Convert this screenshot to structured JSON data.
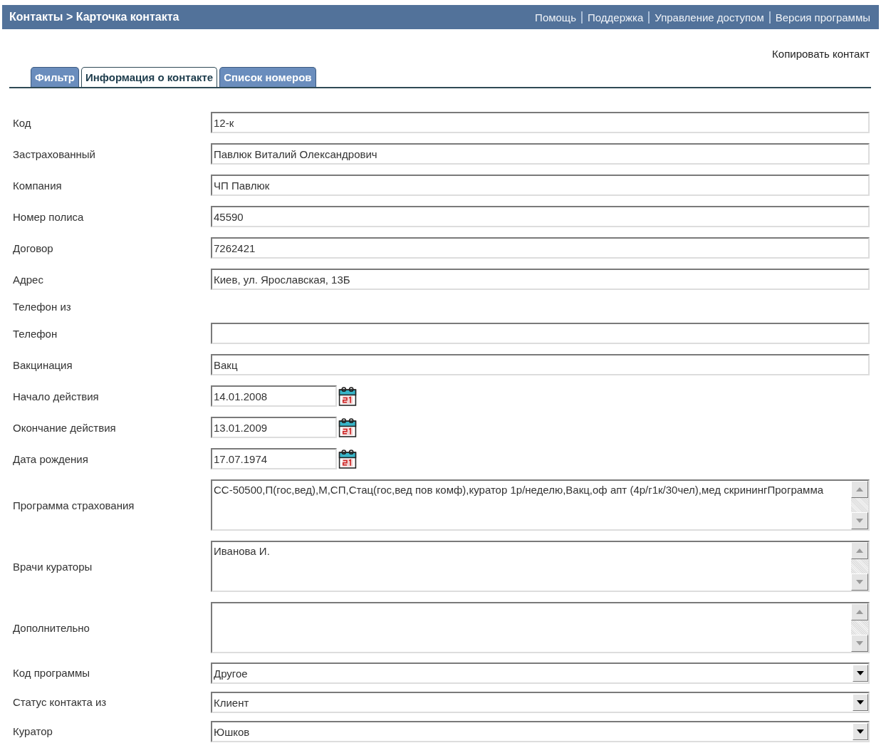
{
  "header": {
    "breadcrumb": "Контакты > Карточка контакта",
    "links": [
      "Помощь",
      "Поддержка",
      "Управление доступом",
      "Версия программы"
    ]
  },
  "copy_link": "Копировать контакт",
  "tabs": [
    {
      "label": "Фильтр",
      "selected": false
    },
    {
      "label": "Информация о контакте",
      "selected": true
    },
    {
      "label": "Список номеров",
      "selected": false
    }
  ],
  "fields": [
    {
      "kind": "text",
      "label": "Код",
      "value": "12-к"
    },
    {
      "kind": "text",
      "label": "Застрахованный",
      "value": "Павлюк Виталий Олександрович"
    },
    {
      "kind": "text",
      "label": "Компания",
      "value": "ЧП Павлюк"
    },
    {
      "kind": "text",
      "label": "Номер полиса",
      "value": "45590"
    },
    {
      "kind": "text",
      "label": "Договор",
      "value": "7262421"
    },
    {
      "kind": "text",
      "label": "Адрес",
      "value": "Киев, ул. Ярославская, 13Б"
    },
    {
      "kind": "label",
      "label": "Телефон из"
    },
    {
      "kind": "text",
      "label": "Телефон"
    },
    {
      "kind": "text",
      "label": "Вакцинация",
      "value": "Вакц"
    },
    {
      "kind": "date",
      "label": "Начало действия",
      "value": "14.01.2008"
    },
    {
      "kind": "date",
      "label": "Окончание действия",
      "value": "13.01.2009"
    },
    {
      "kind": "date",
      "label": "Дата рождения",
      "value": "17.07.1974"
    },
    {
      "kind": "textarea",
      "label": "Программа страхования",
      "value": "СС-50500,П(гос,вед),М,СП,Стац(гос,вед пов комф),куратор 1р/неделю,Вакц,оф апт (4р/г1к/30чел),мед скринингПрограмма"
    },
    {
      "kind": "textarea",
      "label": "Врачи кураторы",
      "value": "Иванова И."
    },
    {
      "kind": "textarea",
      "label": "Дополнительно"
    },
    {
      "kind": "select",
      "label": "Код программы",
      "value": "Другое"
    },
    {
      "kind": "select",
      "label": "Статус контакта из",
      "value": "Клиент"
    },
    {
      "kind": "select",
      "label": "Куратор",
      "value": "Юшков"
    }
  ]
}
